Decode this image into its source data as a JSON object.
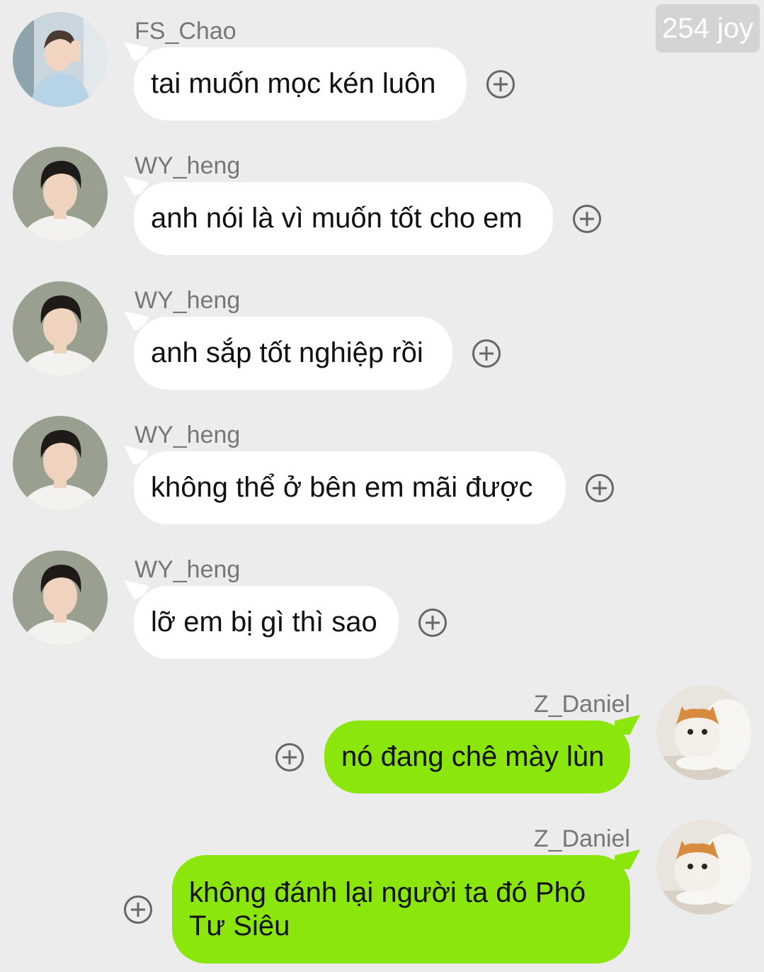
{
  "header": {
    "badge": "254 joy"
  },
  "messages": [
    {
      "sender": "FS_Chao",
      "text": "tai muốn mọc kén luôn",
      "side": "in",
      "avatar": "boy-light-avatar"
    },
    {
      "sender": "WY_heng",
      "text": "anh nói là vì muốn tốt cho em",
      "side": "in",
      "avatar": "boy-dark-avatar"
    },
    {
      "sender": "WY_heng",
      "text": "anh sắp tốt nghiệp rồi",
      "side": "in",
      "avatar": "boy-dark-avatar"
    },
    {
      "sender": "WY_heng",
      "text": "không thể ở bên em mãi được",
      "side": "in",
      "avatar": "boy-dark-avatar"
    },
    {
      "sender": "WY_heng",
      "text": "lỡ em bị gì thì sao",
      "side": "in",
      "avatar": "boy-dark-avatar"
    },
    {
      "sender": "Z_Daniel",
      "text": "nó đang chê mày lùn",
      "side": "out",
      "avatar": "cat-avatar"
    },
    {
      "sender": "Z_Daniel",
      "text": "không đánh lại người ta đó Phó Tư Siêu",
      "side": "out",
      "avatar": "cat-avatar"
    }
  ],
  "colors": {
    "background": "#ececec",
    "incoming_bubble": "#ffffff",
    "outgoing_bubble": "#8be60c",
    "badge": "#d4d4d4"
  }
}
